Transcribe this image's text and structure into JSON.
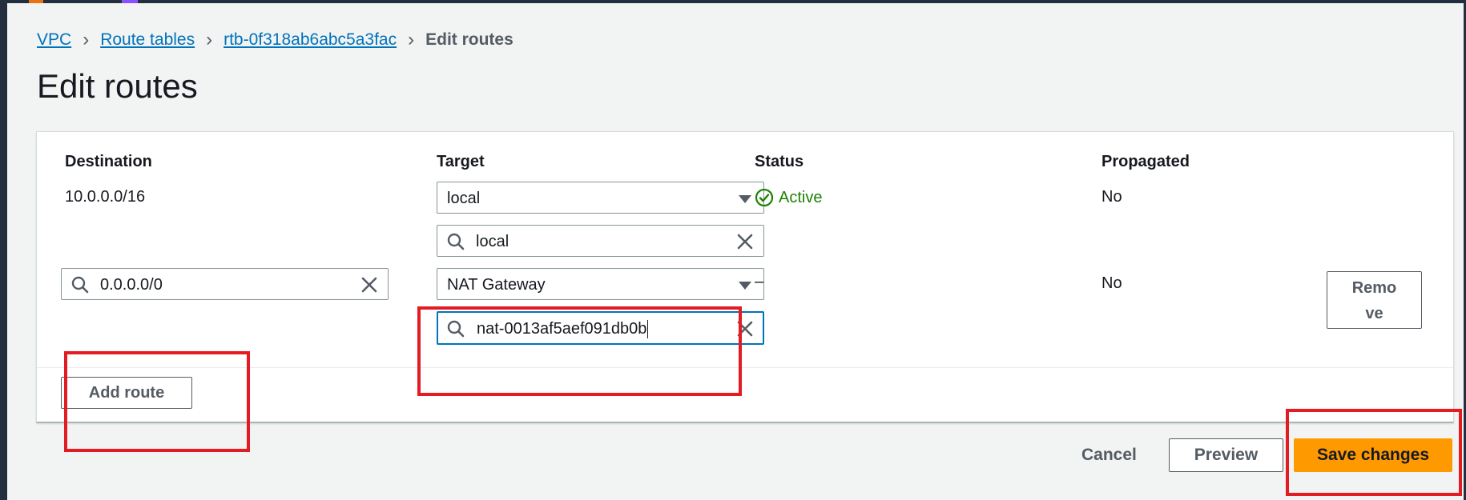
{
  "breadcrumb": {
    "items": [
      "VPC",
      "Route tables",
      "rtb-0f318ab6abc5a3fac"
    ],
    "current": "Edit routes"
  },
  "page_title": "Edit routes",
  "table": {
    "headers": [
      "Destination",
      "Target",
      "Status",
      "Propagated"
    ],
    "rows": [
      {
        "destination": "10.0.0.0/16",
        "target_select": "local",
        "target_search": "local",
        "status": "Active",
        "propagated": "No"
      },
      {
        "destination_input": "0.0.0.0/0",
        "target_select": "NAT Gateway",
        "target_search": "nat-0013af5aef091db0b",
        "status": "–",
        "propagated": "No",
        "remove_label_line1": "Remo",
        "remove_label_line2": "ve"
      }
    ]
  },
  "add_route_label": "Add route",
  "footer": {
    "cancel_label": "Cancel",
    "preview_label": "Preview",
    "save_label": "Save changes"
  },
  "colors": {
    "link": "#0073bb",
    "primary": "#ff9900",
    "status_active": "#1d8102",
    "highlight": "#e31b23"
  },
  "icons": [
    "chevron-right-icon",
    "search-icon",
    "clear-icon",
    "caret-down-icon",
    "check-circle-icon"
  ]
}
